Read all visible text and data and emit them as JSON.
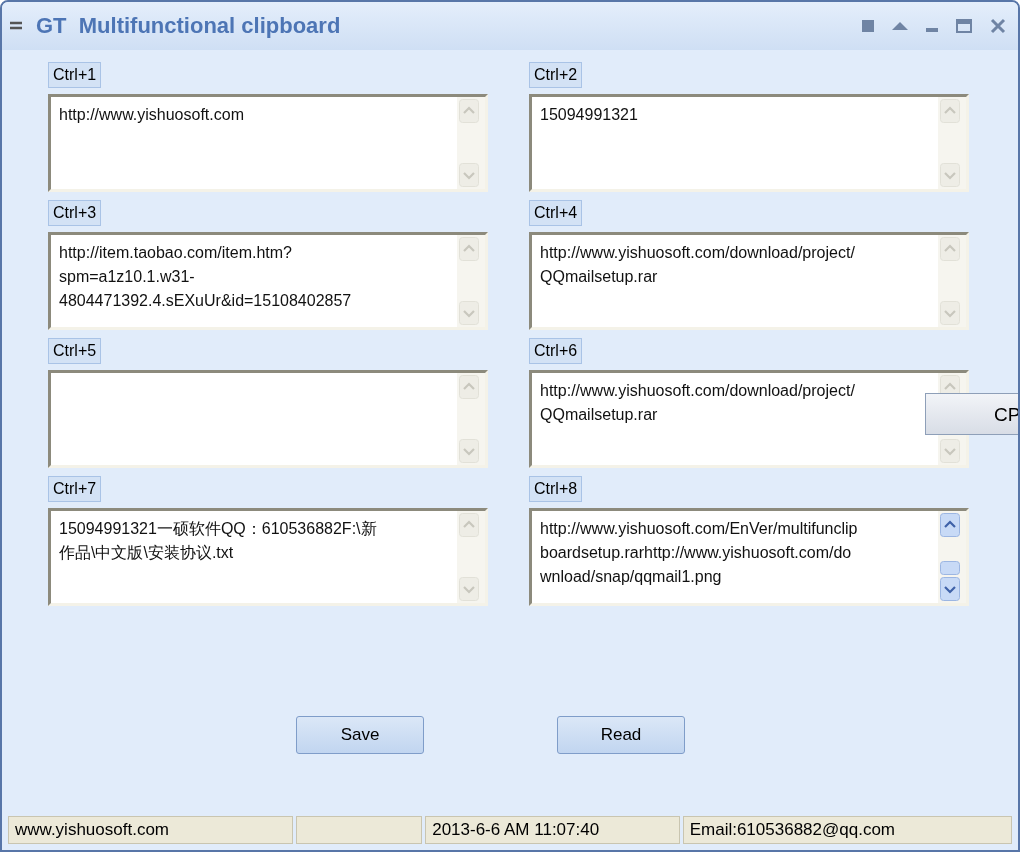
{
  "window": {
    "title": "GT  Multifunctional clipboard"
  },
  "slots": [
    {
      "hotkey": "Ctrl+1",
      "lines": [
        "http://www.yishuosoft.com"
      ],
      "scroll_enabled": false
    },
    {
      "hotkey": "Ctrl+2",
      "lines": [
        "15094991321"
      ],
      "scroll_enabled": false
    },
    {
      "hotkey": "Ctrl+3",
      "lines": [
        "http://item.taobao.com/item.htm?",
        "spm=a1z10.1.w31-",
        "4804471392.4.sEXuUr&id=15108402857"
      ],
      "scroll_enabled": false
    },
    {
      "hotkey": "Ctrl+4",
      "lines": [
        "http://www.yishuosoft.com/download/project/",
        "QQmailsetup.rar"
      ],
      "scroll_enabled": false
    },
    {
      "hotkey": "Ctrl+5",
      "scroll_enabled": false
    },
    {
      "hotkey": "Ctrl+6",
      "lines": [
        "http://www.yishuosoft.com/download/project/",
        "QQmailsetup.rar"
      ],
      "scroll_enabled": false
    },
    {
      "hotkey": "Ctrl+7",
      "lines": [
        "15094991321一硕软件QQ：610536882F:\\新",
        "作品\\中文版\\安装协议.txt"
      ],
      "scroll_enabled": false
    },
    {
      "hotkey": "Ctrl+8",
      "lines": [
        "http://www.yishuosoft.com/EnVer/multifunclip",
        "boardsetup.rarhttp://www.yishuosoft.com/do",
        "wnload/snap/qqmail1.png"
      ],
      "scroll_enabled": true
    }
  ],
  "popup": {
    "label": "CP"
  },
  "buttons": [
    "Save",
    "Read"
  ],
  "status_bar": {
    "site": "www.yishuosoft.com",
    "datetime": "2013-6-6 AM 11:07:40",
    "email": "Email:610536882@qq.com"
  }
}
